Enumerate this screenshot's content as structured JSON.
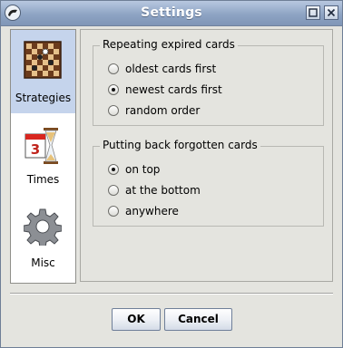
{
  "window": {
    "title": "Settings"
  },
  "sidebar": {
    "items": [
      {
        "label": "Strategies",
        "icon": "chessboard-icon",
        "selected": true
      },
      {
        "label": "Times",
        "icon": "calendar-hourglass-icon",
        "selected": false
      },
      {
        "label": "Misc",
        "icon": "gear-icon",
        "selected": false
      }
    ],
    "calendar_number": "3"
  },
  "groups": [
    {
      "title": "Repeating expired cards",
      "options": [
        "oldest cards first",
        "newest cards first",
        "random order"
      ],
      "selected_index": 1
    },
    {
      "title": "Putting back forgotten cards",
      "options": [
        "on top",
        "at the bottom",
        "anywhere"
      ],
      "selected_index": 0
    }
  ],
  "buttons": {
    "ok": "OK",
    "cancel": "Cancel"
  },
  "colors": {
    "titlebar": "#8ea4c4",
    "selection": "#c5d4ec"
  }
}
